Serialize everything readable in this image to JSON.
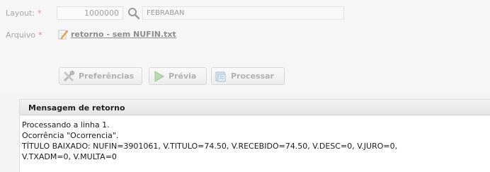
{
  "form": {
    "layout": {
      "label": "Layout:",
      "required_mark": "*",
      "code": "1000000",
      "description": "FEBRABAN"
    },
    "arquivo": {
      "label": "Arquivo",
      "required_mark": "*",
      "file_name": "retorno - sem NUFIN.txt"
    }
  },
  "toolbar": {
    "preferences_label": "Preferências",
    "preview_label": "Prévia",
    "process_label": "Processar"
  },
  "panel": {
    "title": "Mensagem de retorno",
    "lines": [
      "Processando a linha 1.",
      "Ocorrência \"Ocorrencia\".",
      "TÍTULO BAIXADO: NUFIN=3901061, V.TITULO=74.50, V.RECEBIDO=74.50, V.DESC=0, V.JURO=0,",
      "V.TXADM=0, V.MULTA=0"
    ]
  },
  "colors": {
    "required": "#e58a8a",
    "panel_header": "#e8e8e8",
    "disabled_text": "#b0b0b0"
  },
  "icons": {
    "search": "magnifier-icon",
    "file": "file-edit-icon",
    "preferences": "tools-icon",
    "preview": "play-icon",
    "process": "process-icon"
  }
}
